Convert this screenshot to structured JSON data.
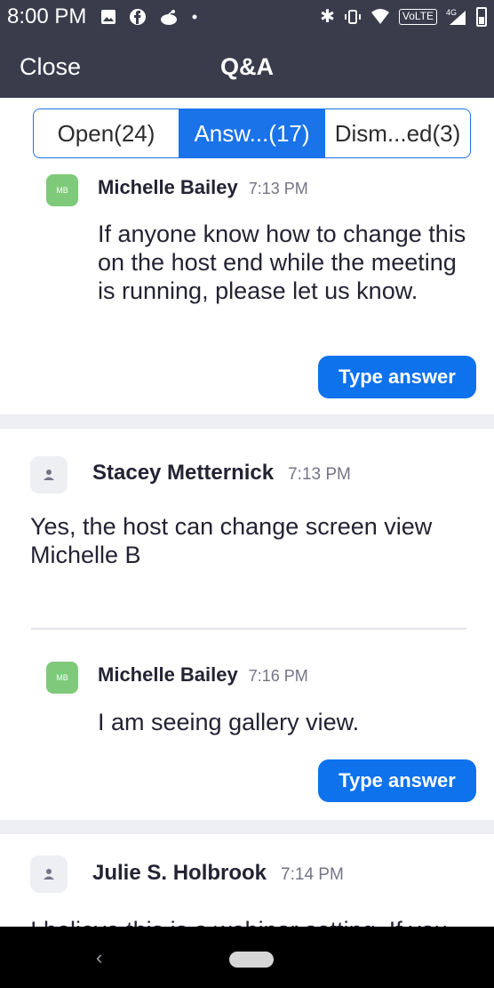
{
  "status_bar": {
    "time": "8:00 PM",
    "icons_left": [
      "image-icon",
      "facebook-icon",
      "reddit-icon",
      "dot-icon"
    ],
    "icons_right": [
      "bluetooth-icon",
      "vibrate-icon",
      "wifi-icon",
      "volte-icon",
      "signal-icon",
      "battery-icon"
    ],
    "volte_label": "VoLTE",
    "network_label": "4G"
  },
  "header": {
    "close_label": "Close",
    "title": "Q&A",
    "background": "#3a3c4c"
  },
  "tabs": [
    {
      "label": "Open(24)",
      "active": false
    },
    {
      "label": "Answ...(17)",
      "active": true
    },
    {
      "label": "Dism...ed(3)",
      "active": false
    }
  ],
  "questions": [
    {
      "author": "Michelle Bailey",
      "initials": "MB",
      "time": "7:13 PM",
      "text": "If anyone know how to change this on the host end while the meeting is running, please let us know.",
      "button": "Type answer"
    },
    {
      "author": "Michelle Bailey",
      "initials": "MB",
      "time": "7:16 PM",
      "text": "I am seeing gallery view.",
      "button": "Type answer"
    }
  ],
  "answers": [
    {
      "author": "Stacey Metternick",
      "time": "7:13 PM",
      "text": "Yes, the host can change screen view Michelle B"
    },
    {
      "author": "Julie S. Holbrook",
      "time": "7:14 PM",
      "text": "I believe this is a webinar setting. If you"
    }
  ],
  "colors": {
    "accent": "#0e72ed",
    "tab_active": "#1a73e8",
    "avatar_green": "#7ec97a",
    "separator": "#eeeff3"
  }
}
